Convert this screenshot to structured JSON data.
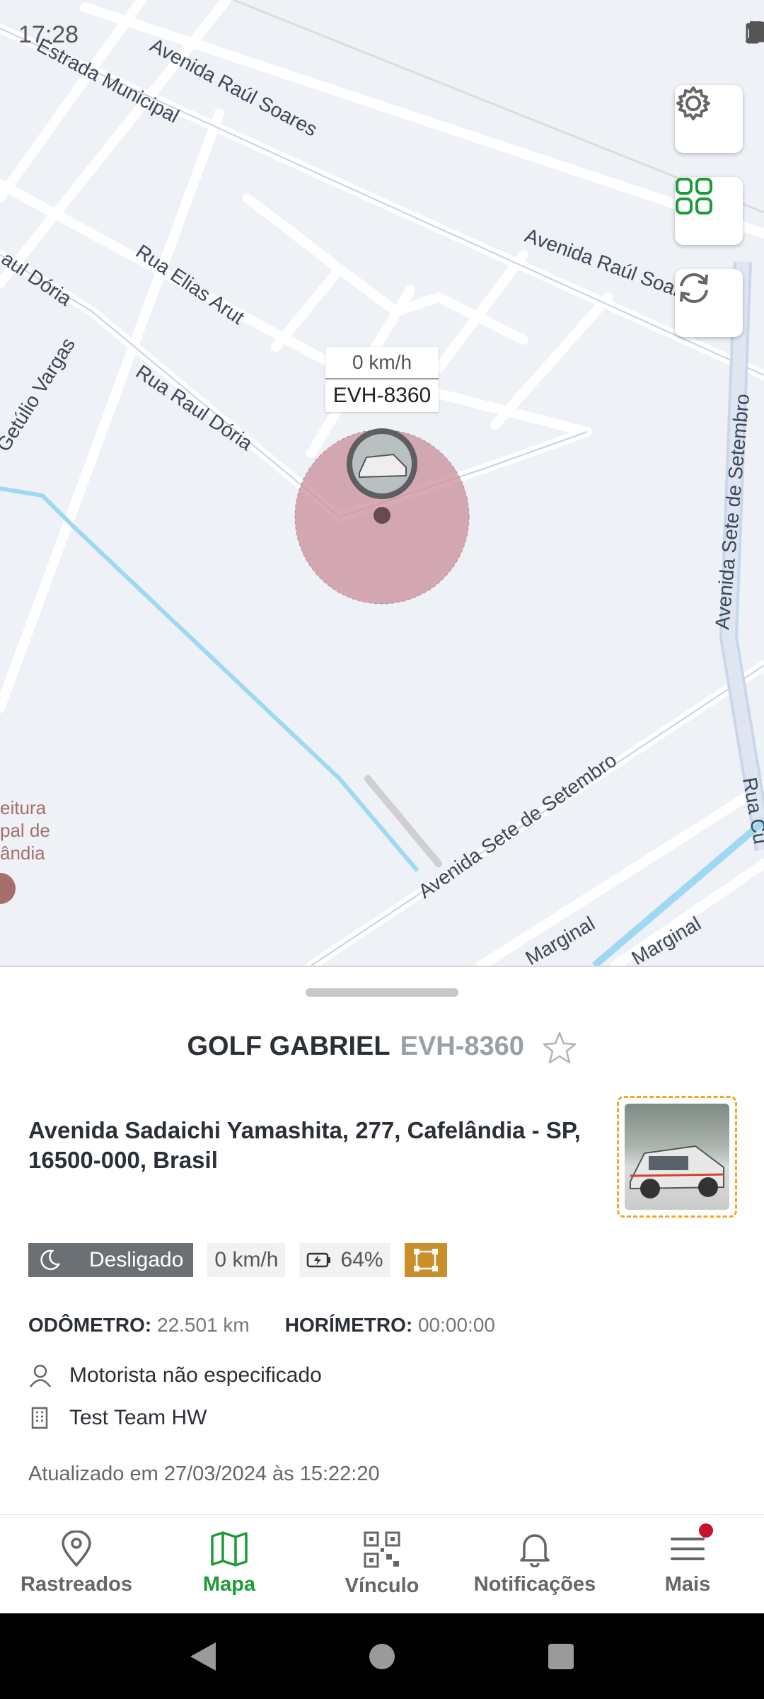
{
  "status_bar": {
    "time": "17:28"
  },
  "map": {
    "streets": [
      "Estrada Municipal",
      "Avenida Raúl Soares",
      "Avenida Raúl Soares",
      "Rua Elias Arut",
      "Raul Dória",
      "Rua Raul Dória",
      "Getúlio Vargas",
      "Avenida Sete de Setembro",
      "Avenida Sete de Setembro",
      "Marginal",
      "Marginal",
      "Rua Cu"
    ],
    "poi_label": "eitura\npal de\nândia",
    "marker": {
      "speed": "0 km/h",
      "plate": "EVH-8360"
    },
    "buttons": {
      "settings": "gear-icon",
      "grid": "grid-icon",
      "refresh": "refresh-icon"
    }
  },
  "sheet": {
    "vehicle_name": "GOLF GABRIEL",
    "vehicle_plate": "EVH-8360",
    "address": "Avenida Sadaichi Yamashita, 277, Cafelândia - SP, 16500-000, Brasil",
    "status": "Desligado",
    "speed": "0 km/h",
    "battery": "64%",
    "odometer_label": "ODÔMETRO:",
    "odometer_value": "22.501 km",
    "hourmeter_label": "HORÍMETRO:",
    "hourmeter_value": "00:00:00",
    "driver": "Motorista não especificado",
    "team": "Test Team HW",
    "updated": "Atualizado em 27/03/2024 às 15:22:20"
  },
  "nav": {
    "items": [
      {
        "label": "Rastreados",
        "icon": "location-pin-icon"
      },
      {
        "label": "Mapa",
        "icon": "map-icon",
        "active": true
      },
      {
        "label": "Vínculo",
        "icon": "qr-code-icon"
      },
      {
        "label": "Notificações",
        "icon": "bell-icon"
      },
      {
        "label": "Mais",
        "icon": "menu-icon"
      }
    ]
  },
  "colors": {
    "accent": "#1f9a3a",
    "status_off": "#6b7075",
    "geofence": "#c98f2a",
    "alert_badge": "#c4142d"
  }
}
